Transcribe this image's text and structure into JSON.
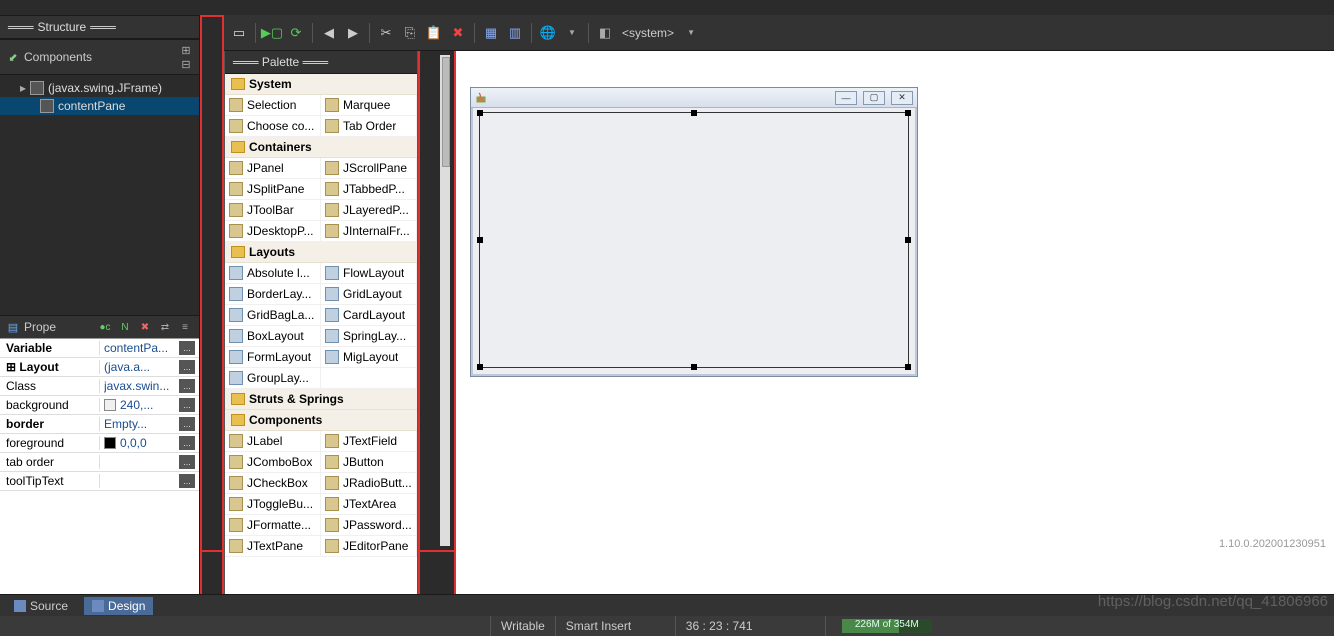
{
  "structure": {
    "title": "Structure"
  },
  "componentsBar": {
    "label": "Components"
  },
  "tree": {
    "root": "(javax.swing.JFrame)",
    "child": "contentPane"
  },
  "propertiesHeader": "Prope",
  "properties": {
    "rows": [
      {
        "name": "Variable",
        "value": "contentPa...",
        "bold": true
      },
      {
        "name": "Layout",
        "value": "(java.a...",
        "bold": true,
        "expander": true
      },
      {
        "name": "Class",
        "value": "javax.swin..."
      },
      {
        "name": "background",
        "value": "240,...",
        "swatch": "#f0f0f0"
      },
      {
        "name": "border",
        "value": "Empty...",
        "bold": true
      },
      {
        "name": "foreground",
        "value": "0,0,0",
        "swatch": "#000000"
      },
      {
        "name": "tab order",
        "value": ""
      },
      {
        "name": "toolTipText",
        "value": ""
      }
    ]
  },
  "paletteHeader": "Palette",
  "palette": [
    {
      "cat": "System",
      "items": [
        [
          "Selection",
          "Marquee"
        ],
        [
          "Choose co...",
          "Tab Order"
        ]
      ]
    },
    {
      "cat": "Containers",
      "items": [
        [
          "JPanel",
          "JScrollPane"
        ],
        [
          "JSplitPane",
          "JTabbedP..."
        ],
        [
          "JToolBar",
          "JLayeredP..."
        ],
        [
          "JDesktopP...",
          "JInternalFr..."
        ]
      ]
    },
    {
      "cat": "Layouts",
      "items": [
        [
          "Absolute l...",
          "FlowLayout"
        ],
        [
          "BorderLay...",
          "GridLayout"
        ],
        [
          "GridBagLa...",
          "CardLayout"
        ],
        [
          "BoxLayout",
          "SpringLay..."
        ],
        [
          "FormLayout",
          "MigLayout"
        ],
        [
          "GroupLay...",
          ""
        ]
      ]
    },
    {
      "cat": "Struts & Springs",
      "items": []
    },
    {
      "cat": "Components",
      "items": [
        [
          "JLabel",
          "JTextField"
        ],
        [
          "JComboBox",
          "JButton"
        ],
        [
          "JCheckBox",
          "JRadioButt..."
        ],
        [
          "JToggleBu...",
          "JTextArea"
        ],
        [
          "JFormatte...",
          "JPassword..."
        ],
        [
          "JTextPane",
          "JEditorPane"
        ]
      ]
    }
  ],
  "toolbar": {
    "system": "<system>"
  },
  "bottomTabs": {
    "source": "Source",
    "design": "Design"
  },
  "status": {
    "writable": "Writable",
    "insert": "Smart Insert",
    "pos": "36 : 23 : 741",
    "heap": "226M of 354M"
  },
  "version": "1.10.0.202001230951",
  "watermark": "https://blog.csdn.net/qq_41806966"
}
